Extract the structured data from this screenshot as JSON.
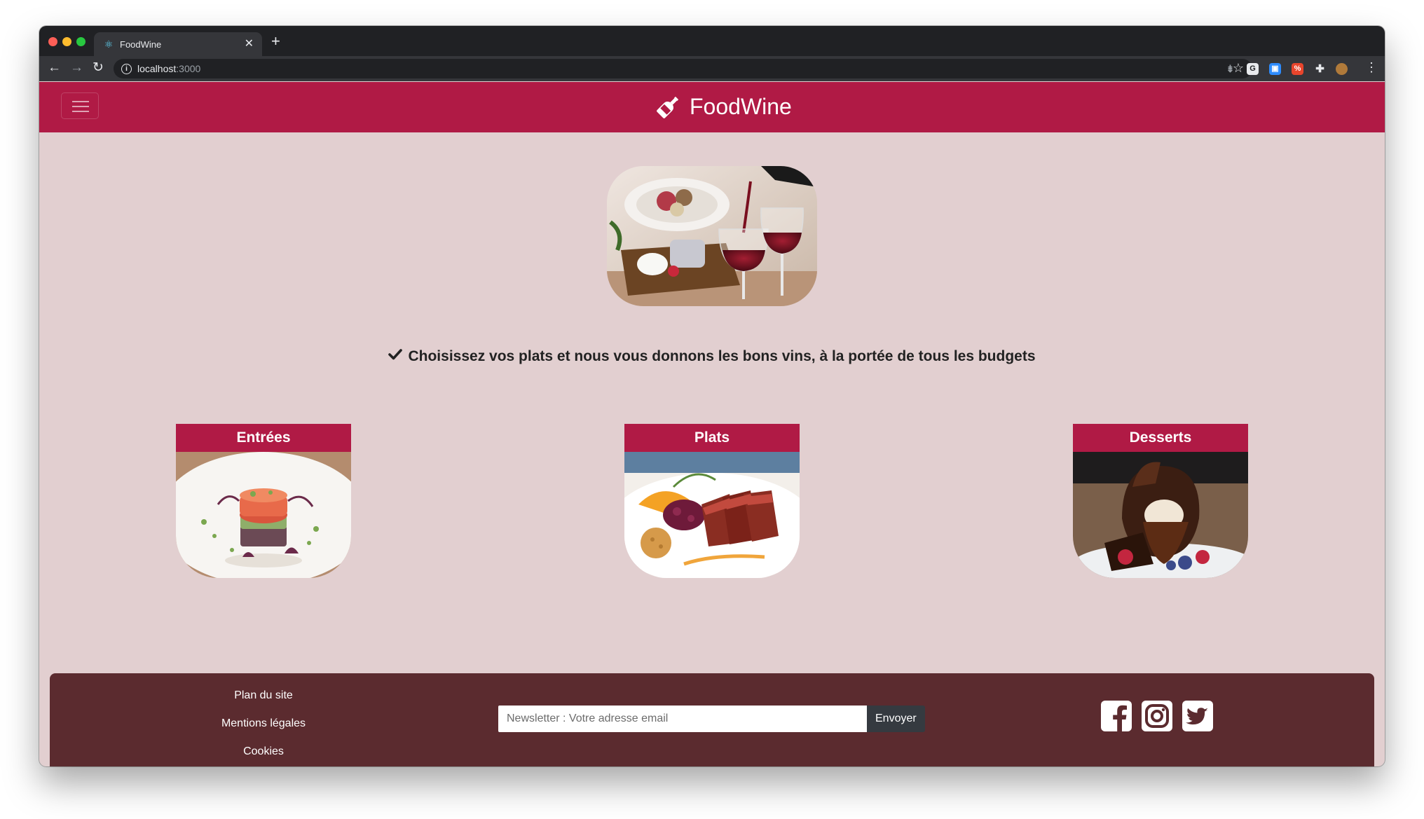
{
  "browser": {
    "tab_title": "FoodWine",
    "url_host": "localhost",
    "url_port": ":3000"
  },
  "header": {
    "brand": "FoodWine"
  },
  "main": {
    "tagline": "Choisissez vos plats et nous vous donnons les bons vins, à la portée de tous les budgets",
    "categories": [
      {
        "title": "Entrées"
      },
      {
        "title": "Plats"
      },
      {
        "title": "Desserts"
      }
    ]
  },
  "footer": {
    "links": [
      "Plan du site",
      "Mentions légales",
      "Cookies"
    ],
    "newsletter_placeholder": "Newsletter : Votre adresse email",
    "newsletter_button": "Envoyer",
    "socials": [
      "facebook",
      "instagram",
      "twitter"
    ]
  },
  "colors": {
    "primary": "#b01a45",
    "background": "#e2cfd0",
    "footer": "#5b2b2f"
  }
}
